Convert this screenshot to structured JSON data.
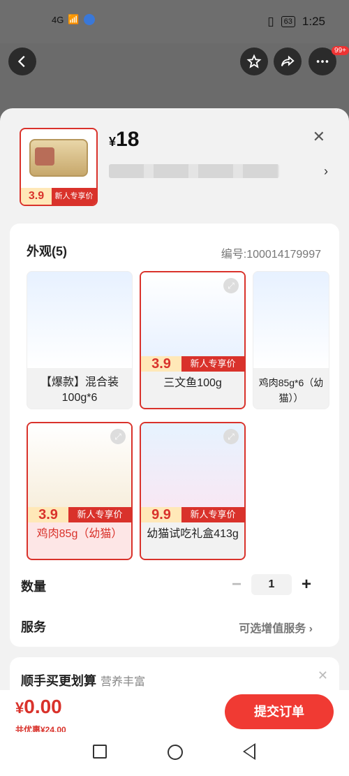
{
  "status": {
    "signal": "4G",
    "battery": "63",
    "time": "1:25"
  },
  "nav": {
    "badge": "99+"
  },
  "product": {
    "price_symbol": "¥",
    "price": "18",
    "thumb_price": "3.9",
    "thumb_tag": "新人专享价"
  },
  "appearance": {
    "title": "外观(5)",
    "sku_label": "编号:100014179997",
    "options": [
      {
        "label": "【爆款】混合装100g*6",
        "selected": false
      },
      {
        "label": "三文鱼100g",
        "price": "3.9",
        "tag": "新人专享价",
        "selected": false
      },
      {
        "label": "鸡肉85g*6（幼猫））",
        "selected": false
      },
      {
        "label": "鸡肉85g（幼猫）",
        "price": "3.9",
        "tag": "新人专享价",
        "selected": true
      },
      {
        "label": "幼猫试吃礼盒413g",
        "price": "9.9",
        "tag": "新人专享价",
        "selected": false
      }
    ]
  },
  "quantity": {
    "label": "数量",
    "value": "1",
    "minus": "−",
    "plus": "+"
  },
  "service": {
    "label": "服务",
    "value": "可选增值服务 ›"
  },
  "bundle": {
    "title": "顺手买更划算",
    "subtitle": "营养丰富"
  },
  "checkout": {
    "total_symbol": "¥",
    "total": "0.00",
    "discount": "共优惠¥24.00",
    "submit": "提交订单"
  },
  "colors": {
    "accent": "#d9322b",
    "submit": "#f03a33"
  }
}
